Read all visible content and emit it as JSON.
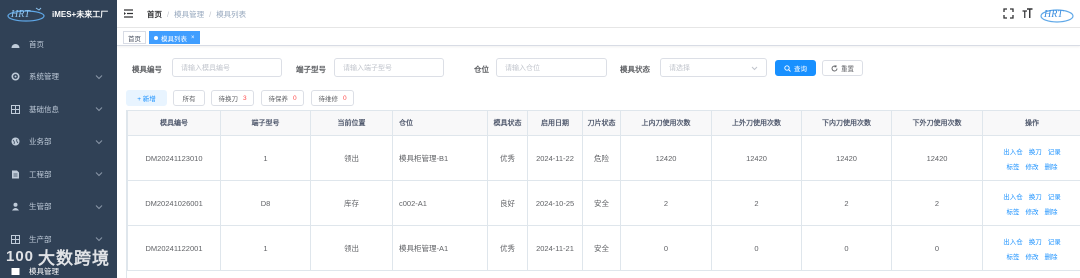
{
  "app": {
    "title": "iMES+未来工厂",
    "logo_text": "HRT"
  },
  "sidebar": {
    "items": [
      {
        "label": "首页",
        "icon": "dashboard-icon",
        "has_children": false
      },
      {
        "label": "系统管理",
        "icon": "gear-icon",
        "has_children": true
      },
      {
        "label": "基础信息",
        "icon": "grid-icon",
        "has_children": true
      },
      {
        "label": "业务部",
        "icon": "globe-icon",
        "has_children": true
      },
      {
        "label": "工程部",
        "icon": "document-icon",
        "has_children": true
      },
      {
        "label": "生管部",
        "icon": "person-icon",
        "has_children": true
      },
      {
        "label": "生产部",
        "icon": "grid-icon",
        "has_children": true
      },
      {
        "label": "模具管理",
        "icon": "mold-icon",
        "has_children": true
      }
    ],
    "watermark": "大数跨境",
    "watermark_logo": "100"
  },
  "header": {
    "breadcrumb": [
      "首页",
      "模具管理",
      "模具列表"
    ],
    "logo_text": "HRT"
  },
  "tags": [
    {
      "label": "首页",
      "active": false
    },
    {
      "label": "模具列表",
      "active": true
    }
  ],
  "search": {
    "mold_no": {
      "label": "模具编号",
      "placeholder": "请输入模具编号"
    },
    "terminal": {
      "label": "端子型号",
      "placeholder": "请输入端子型号"
    },
    "location": {
      "label": "仓位",
      "placeholder": "请输入仓位"
    },
    "status": {
      "label": "模具状态",
      "placeholder": "请选择"
    },
    "search_btn": "查询",
    "reset_btn": "重置"
  },
  "toolbar": {
    "add": "+ 新增",
    "all": "所有",
    "pending_knife": {
      "label": "待换刀",
      "count": "3"
    },
    "pending_maintain": {
      "label": "待保养",
      "count": "0"
    },
    "pending_repair": {
      "label": "待维修",
      "count": "0"
    }
  },
  "table": {
    "columns": [
      "模具编号",
      "端子型号",
      "当前位置",
      "仓位",
      "模具状态",
      "启用日期",
      "刀片状态",
      "上内刀使用次数",
      "上外刀使用次数",
      "下内刀使用次数",
      "下外刀使用次数",
      "操作"
    ],
    "rows": [
      {
        "mold_no": "DM20241123010",
        "terminal": "1",
        "position": "领出",
        "location": "模具柜管理-B1",
        "status": "优秀",
        "date": "2024-11-22",
        "blade": "危险",
        "ui": "12420",
        "uo": "12420",
        "li": "12420",
        "lo": "12420"
      },
      {
        "mold_no": "DM20241026001",
        "terminal": "D8",
        "position": "库存",
        "location": "c002-A1",
        "status": "良好",
        "date": "2024-10-25",
        "blade": "安全",
        "ui": "2",
        "uo": "2",
        "li": "2",
        "lo": "2"
      },
      {
        "mold_no": "DM20241122001",
        "terminal": "1",
        "position": "领出",
        "location": "模具柜管理-A1",
        "status": "优秀",
        "date": "2024-11-21",
        "blade": "安全",
        "ui": "0",
        "uo": "0",
        "li": "0",
        "lo": "0"
      }
    ],
    "ops": [
      "出入仓",
      "换刀",
      "记录",
      "标签",
      "修改",
      "删除"
    ]
  },
  "colors": {
    "sidebar_bg": "#304156",
    "primary": "#1890ff",
    "danger": "#ff4949"
  }
}
